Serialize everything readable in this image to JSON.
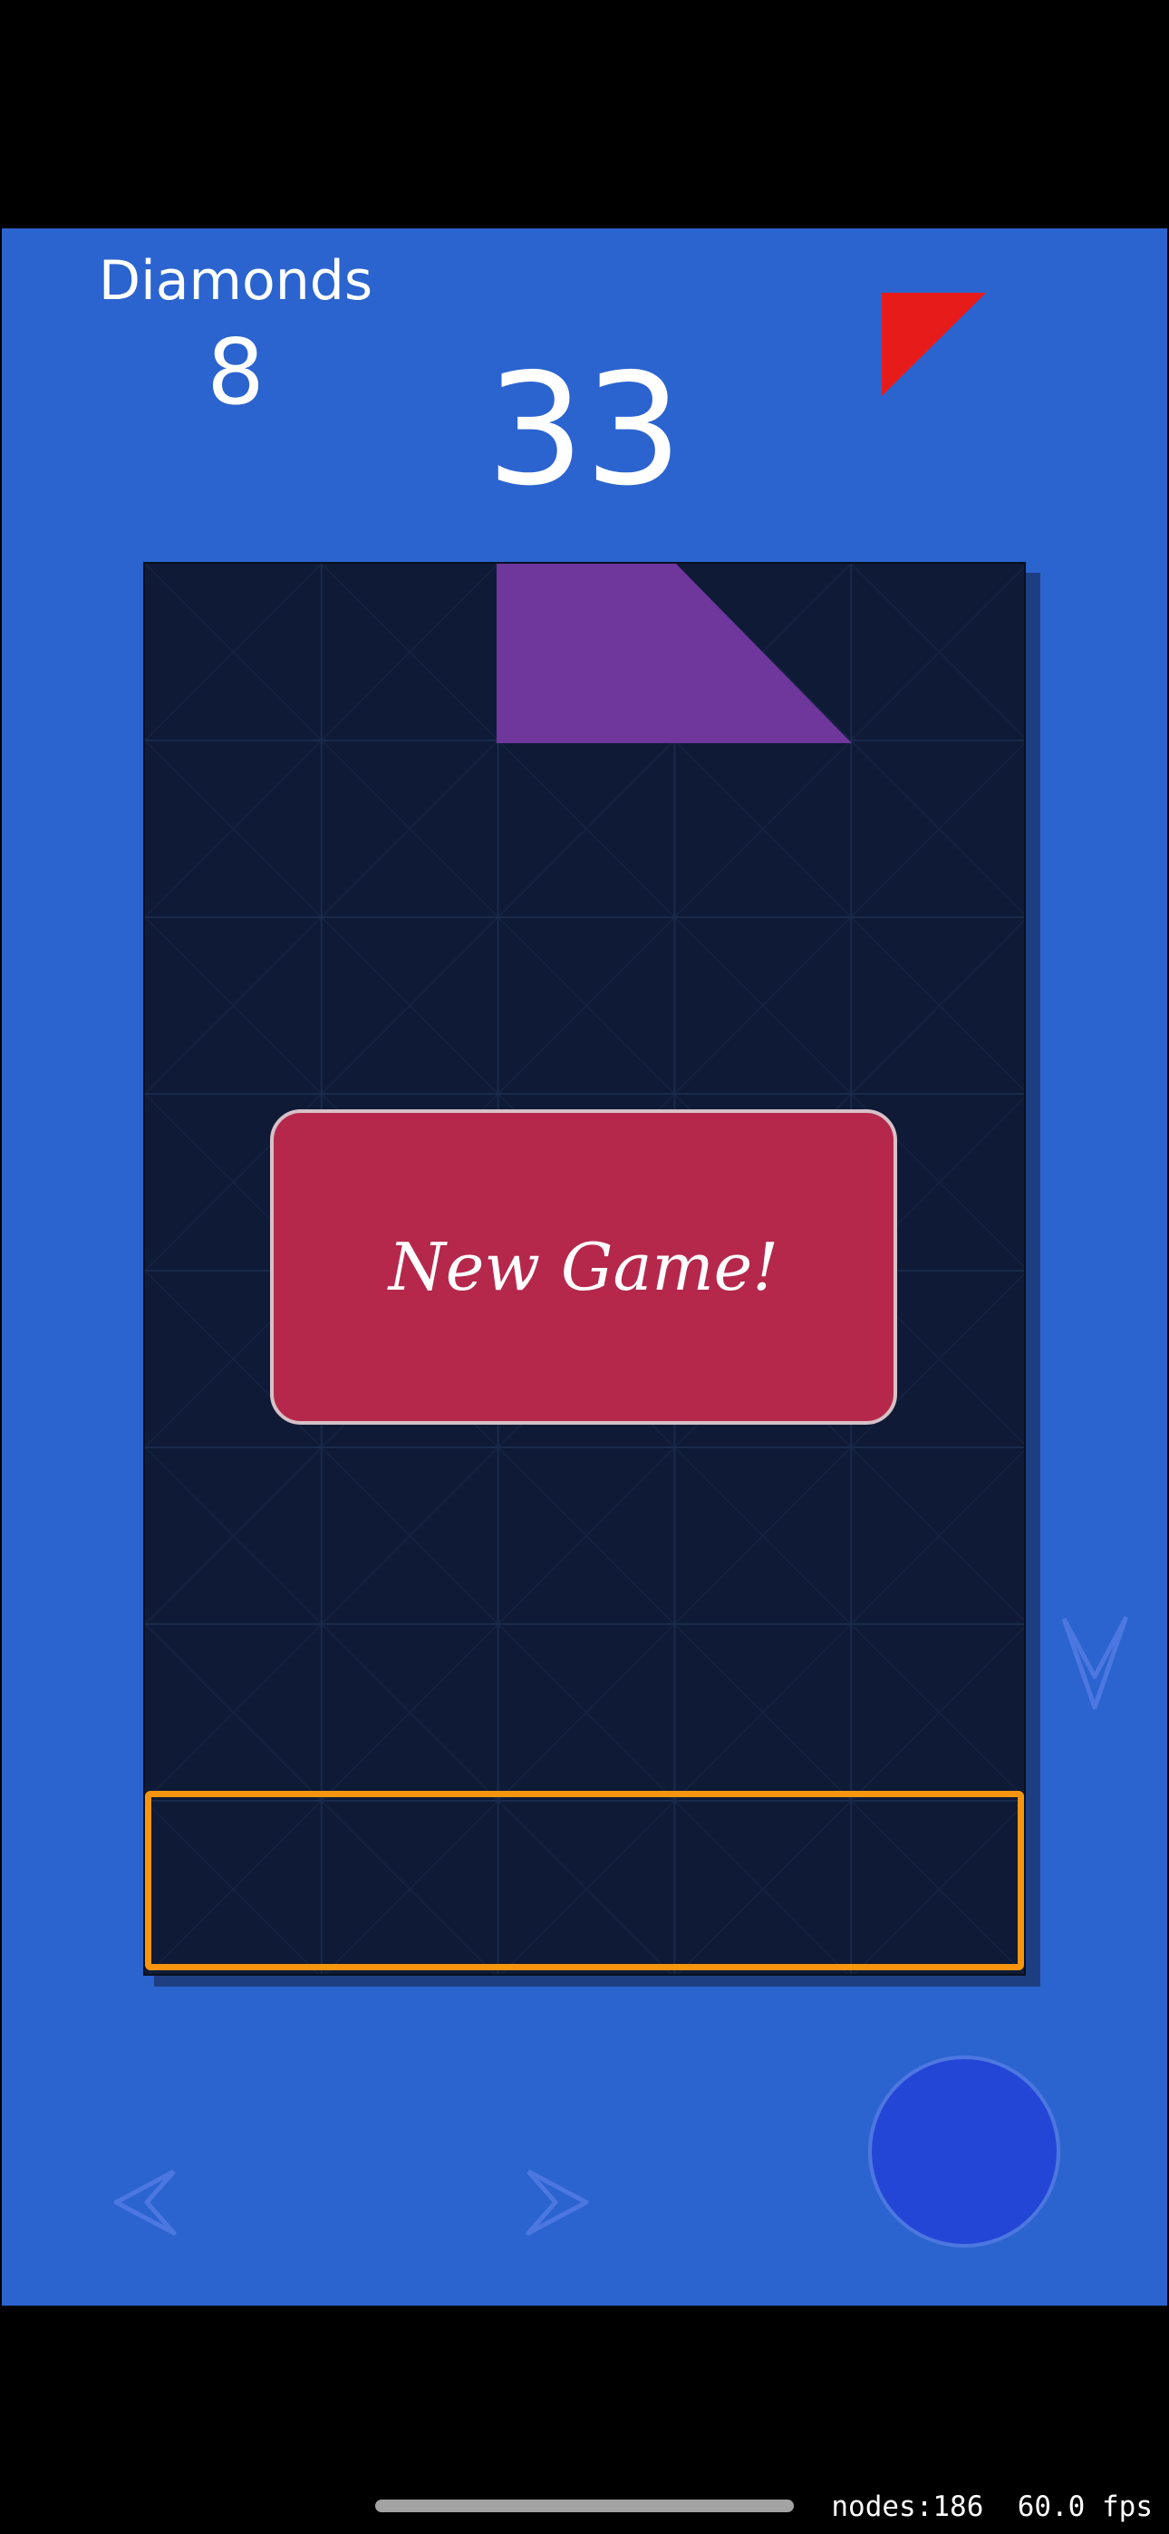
{
  "hud": {
    "score_label": "Diamonds",
    "score_value": "8",
    "timer": "33"
  },
  "next_piece": {
    "shape": "right-triangle",
    "icon": "red-triangle-icon",
    "color": "#e81b1b"
  },
  "board": {
    "columns": 5,
    "rows": 8,
    "background": "#0e1a36",
    "active_piece": {
      "shape": "trapezoid",
      "color": "#6f369c",
      "column": 2,
      "row": 0
    },
    "drop_zone_color": "#f7950f"
  },
  "overlay": {
    "new_game_label": "New Game!"
  },
  "controls": {
    "left_icon": "chevron-left-icon",
    "right_icon": "chevron-right-icon",
    "down_icon": "chevron-down-icon",
    "rotate_icon": "circle-button-icon"
  },
  "colors": {
    "background": "#2b64cf",
    "control_stroke": "#4d77e0",
    "rotate_fill": "#2446d6"
  },
  "debug": {
    "stats": "nodes:186  60.0 fps"
  }
}
